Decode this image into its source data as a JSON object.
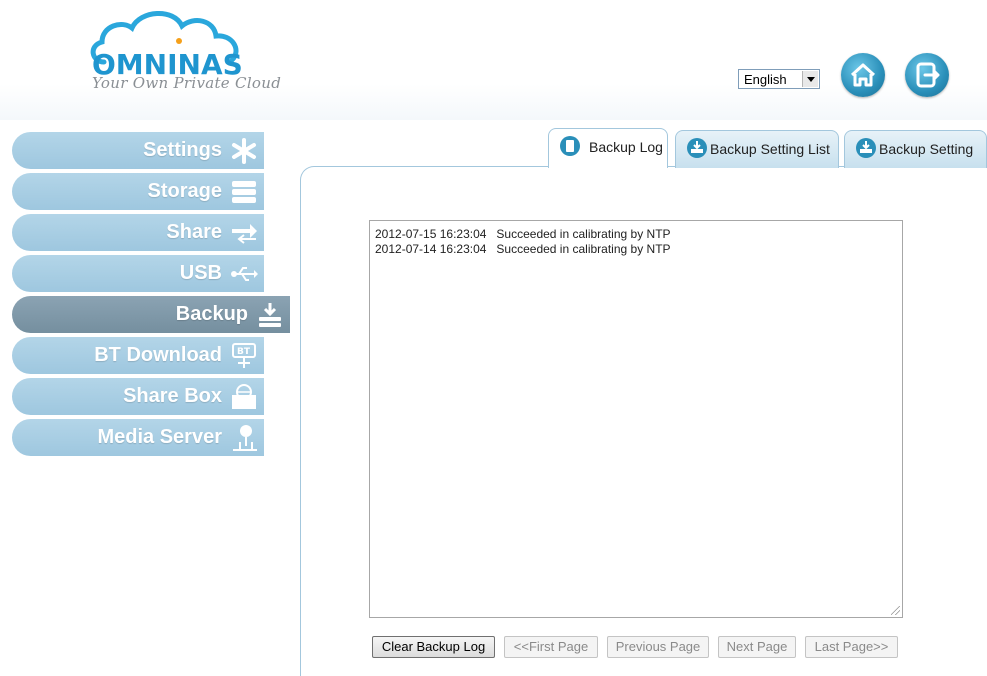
{
  "brand": {
    "name": "OMNINAS",
    "tagline": "Your Own Private Cloud"
  },
  "header": {
    "language": "English",
    "home_icon": "home-icon",
    "logout_icon": "logout-icon"
  },
  "sidebar": {
    "items": [
      {
        "label": "Settings",
        "icon": "settings-icon"
      },
      {
        "label": "Storage",
        "icon": "storage-icon"
      },
      {
        "label": "Share",
        "icon": "share-icon"
      },
      {
        "label": "USB",
        "icon": "usb-icon"
      },
      {
        "label": "Backup",
        "icon": "backup-icon",
        "active": true
      },
      {
        "label": "BT Download",
        "icon": "bt-download-icon"
      },
      {
        "label": "Share Box",
        "icon": "share-box-icon"
      },
      {
        "label": "Media Server",
        "icon": "media-server-icon"
      }
    ]
  },
  "tabs": [
    {
      "label": "Backup Log",
      "active": true
    },
    {
      "label": "Backup Setting List",
      "active": false
    },
    {
      "label": "Backup Setting",
      "active": false
    }
  ],
  "log": {
    "lines": [
      "2012-07-15 16:23:04   Succeeded in calibrating by NTP",
      "2012-07-14 16:23:04   Succeeded in calibrating by NTP"
    ]
  },
  "buttons": {
    "clear": "Clear Backup Log",
    "first": "<<First Page",
    "previous": "Previous Page",
    "next": "Next Page",
    "last": "Last Page>>"
  },
  "colors": {
    "accent": "#2a8fb9",
    "nav": "#a9cfe4",
    "nav_active": "#7d96a6"
  }
}
